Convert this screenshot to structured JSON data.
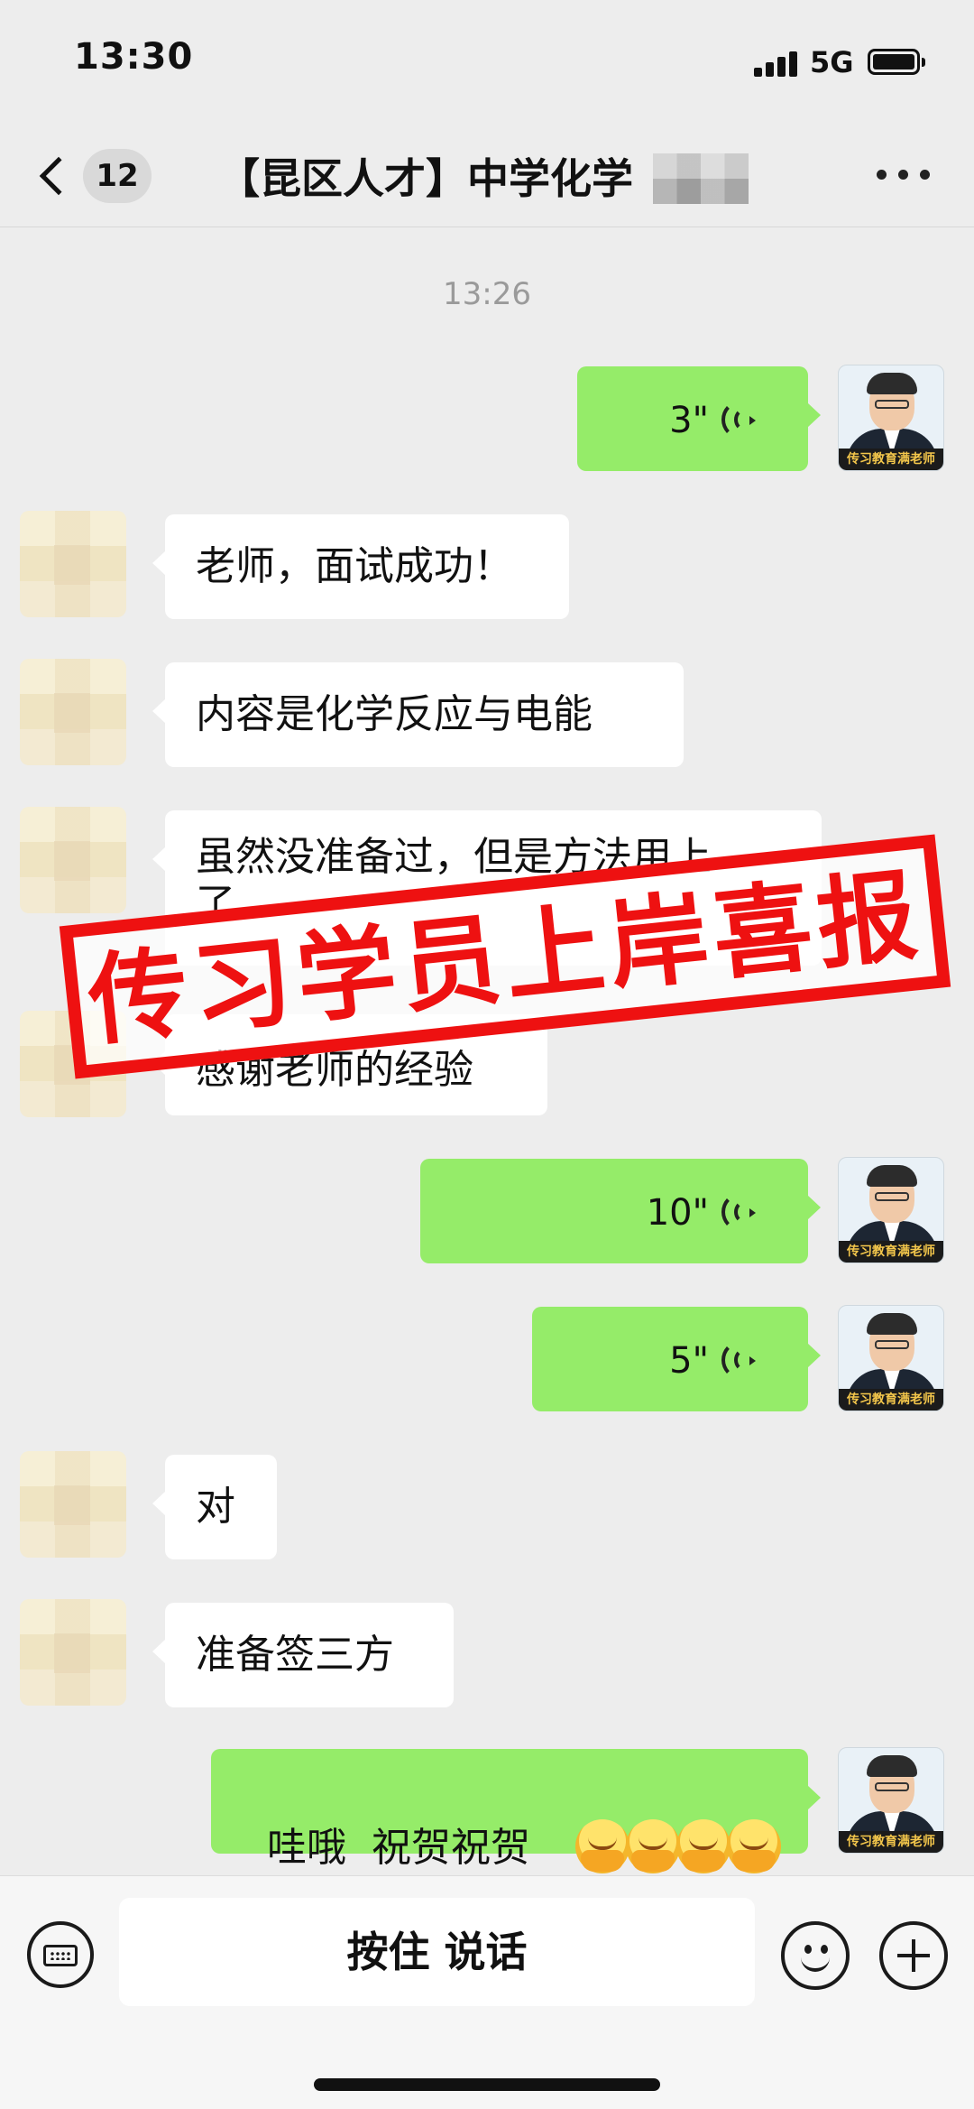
{
  "status_bar": {
    "time": "13:30",
    "network": "5G",
    "signal_bars": 4,
    "battery_level": 1.0
  },
  "header": {
    "back_icon": "chevron-left-icon",
    "unread_count": "12",
    "title": "【昆区人才】中学化学",
    "more_icon": "ellipsis-icon"
  },
  "chat": {
    "timestamp": "13:26",
    "teacher_avatar_caption": "传习教育满老师",
    "messages": [
      {
        "side": "right",
        "type": "voice",
        "duration": "3\""
      },
      {
        "side": "left",
        "type": "text",
        "text": "老师，面试成功！"
      },
      {
        "side": "left",
        "type": "text",
        "text": "内容是化学反应与电能"
      },
      {
        "side": "left",
        "type": "text",
        "line1": "虽然没准备过，但是方法用上",
        "line2": "了"
      },
      {
        "side": "left",
        "type": "text",
        "text": "感谢老师的经验"
      },
      {
        "side": "right",
        "type": "voice",
        "duration": "10\""
      },
      {
        "side": "right",
        "type": "voice",
        "duration": "5\""
      },
      {
        "side": "left",
        "type": "text",
        "text": "对"
      },
      {
        "side": "left",
        "type": "text",
        "text": "准备签三方"
      },
      {
        "side": "right",
        "type": "text",
        "text": "哇哦  祝贺祝贺",
        "emoji": "applause-face-emoji",
        "emoji_count": 4
      }
    ]
  },
  "stamp": {
    "text": "传习学员上岸喜报",
    "color": "#ee1111"
  },
  "input_bar": {
    "keyboard_icon": "keyboard-icon",
    "hold_to_talk": "按住 说话",
    "emoji_icon": "smiley-icon",
    "plus_icon": "plus-icon"
  },
  "colors": {
    "background": "#ededed",
    "bubble_sent": "#95ec69",
    "bubble_received": "#ffffff"
  }
}
